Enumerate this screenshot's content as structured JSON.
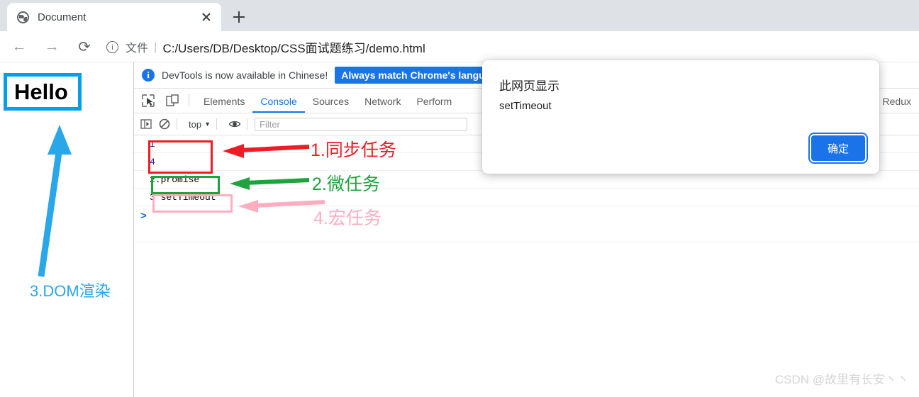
{
  "browser": {
    "tab": {
      "title": "Document",
      "favicon": "globe-icon",
      "close": "close-icon"
    },
    "new_tab": "plus-icon",
    "nav": {
      "back": "←",
      "forward": "→",
      "reload": "⟳"
    },
    "omnibox": {
      "info_icon": "i",
      "scheme_label": "文件",
      "separator": "|",
      "url": "C:/Users/DB/Desktop/CSS面试题练习/demo.html"
    }
  },
  "page": {
    "hello_text": "Hello",
    "hello_border_color": "#00A0E9",
    "dom_label": "3.DOM渲染",
    "dom_label_color": "#29A7E8"
  },
  "devtools": {
    "notice": {
      "icon": "info-icon",
      "text": "DevTools is now available in Chinese!",
      "button_label": "Always match Chrome's langu"
    },
    "toolbar_icons": {
      "inspect": "inspect-element-icon",
      "device": "device-toolbar-icon"
    },
    "tabs": [
      {
        "label": "Elements",
        "selected": false
      },
      {
        "label": "Console",
        "selected": true
      },
      {
        "label": "Sources",
        "selected": false
      },
      {
        "label": "Network",
        "selected": false
      },
      {
        "label": "Perform",
        "selected": false
      }
    ],
    "right_tabs": [
      {
        "label": "Redux",
        "selected": false
      }
    ],
    "console_toolbar": {
      "sidebar_icon": "console-sidebar-icon",
      "clear_icon": "clear-console-icon",
      "context_label": "top",
      "context_caret": "▼",
      "eye_icon": "live-expression-eye-icon",
      "filter_placeholder": "Filter"
    },
    "console_rows": [
      {
        "text": "1",
        "kind": "number"
      },
      {
        "text": "4",
        "kind": "number"
      },
      {
        "text": "2.promise",
        "kind": "text"
      },
      {
        "text": "3 setTimeout",
        "kind": "text"
      }
    ],
    "prompt_caret": ">"
  },
  "annotations": [
    {
      "label": "1.同步任务",
      "color": "#ee1c25"
    },
    {
      "label": "2.微任务",
      "color": "#1fa33f"
    },
    {
      "label": "4.宏任务",
      "color": "#ffaec1"
    }
  ],
  "alert_dialog": {
    "title": "此网页显示",
    "message": "setTimeout",
    "ok_label": "确定"
  },
  "watermark": "CSDN @故里有长安丶丶"
}
